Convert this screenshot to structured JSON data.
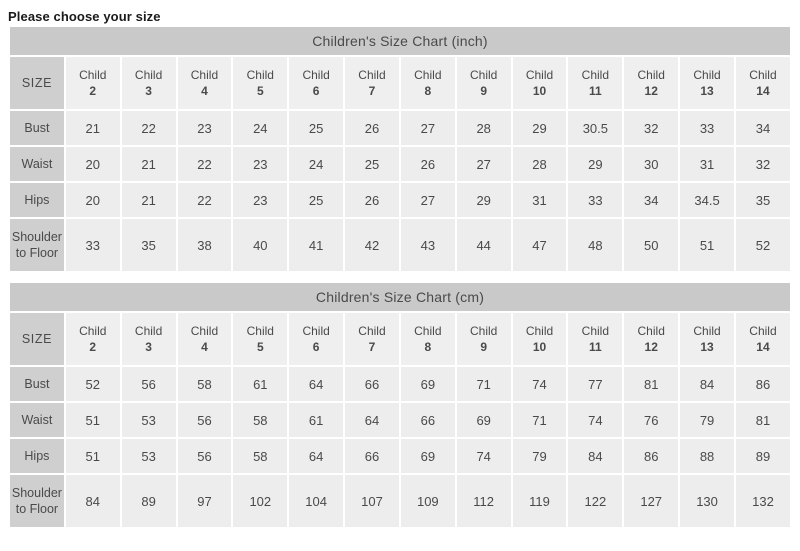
{
  "heading": "Please choose your size",
  "colors": {
    "title_bar_bg": "#c9c9c9",
    "header_bg": "#efefef",
    "row_label_bg": "#cfcfcf",
    "data_bg": "#ededed",
    "text": "#4a4a4a",
    "heading_text": "#1a1a1a",
    "grid_line": "#ffffff"
  },
  "size_label": "SIZE",
  "column_prefix": "Child",
  "columns": [
    "2",
    "3",
    "4",
    "5",
    "6",
    "7",
    "8",
    "9",
    "10",
    "11",
    "12",
    "13",
    "14"
  ],
  "row_labels": [
    "Bust",
    "Waist",
    "Hips",
    "Shoulder to Floor"
  ],
  "chart_data": [
    {
      "type": "table",
      "title": "Children's Size Chart (inch)",
      "unit": "inch",
      "corner_label": "SIZE",
      "categories": [
        "Child 2",
        "Child 3",
        "Child 4",
        "Child 5",
        "Child 6",
        "Child 7",
        "Child 8",
        "Child 9",
        "Child 10",
        "Child 11",
        "Child 12",
        "Child 13",
        "Child 14"
      ],
      "series": [
        {
          "name": "Bust",
          "values": [
            "21",
            "22",
            "23",
            "24",
            "25",
            "26",
            "27",
            "28",
            "29",
            "30.5",
            "32",
            "33",
            "34"
          ]
        },
        {
          "name": "Waist",
          "values": [
            "20",
            "21",
            "22",
            "23",
            "24",
            "25",
            "26",
            "27",
            "28",
            "29",
            "30",
            "31",
            "32"
          ]
        },
        {
          "name": "Hips",
          "values": [
            "20",
            "21",
            "22",
            "23",
            "25",
            "26",
            "27",
            "29",
            "31",
            "33",
            "34",
            "34.5",
            "35"
          ]
        },
        {
          "name": "Shoulder to Floor",
          "values": [
            "33",
            "35",
            "38",
            "40",
            "41",
            "42",
            "43",
            "44",
            "47",
            "48",
            "50",
            "51",
            "52"
          ]
        }
      ]
    },
    {
      "type": "table",
      "title": "Children's Size Chart (cm)",
      "unit": "cm",
      "corner_label": "SIZE",
      "categories": [
        "Child 2",
        "Child 3",
        "Child 4",
        "Child 5",
        "Child 6",
        "Child 7",
        "Child 8",
        "Child 9",
        "Child 10",
        "Child 11",
        "Child 12",
        "Child 13",
        "Child 14"
      ],
      "series": [
        {
          "name": "Bust",
          "values": [
            "52",
            "56",
            "58",
            "61",
            "64",
            "66",
            "69",
            "71",
            "74",
            "77",
            "81",
            "84",
            "86"
          ]
        },
        {
          "name": "Waist",
          "values": [
            "51",
            "53",
            "56",
            "58",
            "61",
            "64",
            "66",
            "69",
            "71",
            "74",
            "76",
            "79",
            "81"
          ]
        },
        {
          "name": "Hips",
          "values": [
            "51",
            "53",
            "56",
            "58",
            "64",
            "66",
            "69",
            "74",
            "79",
            "84",
            "86",
            "88",
            "89"
          ]
        },
        {
          "name": "Shoulder to Floor",
          "values": [
            "84",
            "89",
            "97",
            "102",
            "104",
            "107",
            "109",
            "112",
            "119",
            "122",
            "127",
            "130",
            "132"
          ]
        }
      ]
    }
  ]
}
